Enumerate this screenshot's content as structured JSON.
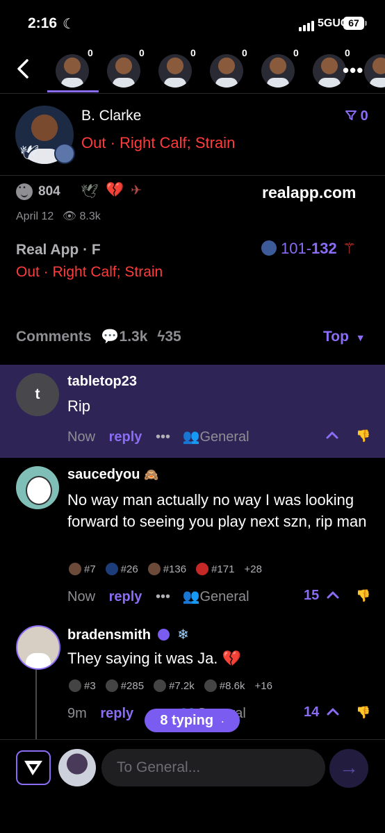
{
  "status_bar": {
    "time": "2:16",
    "network": "5GUC",
    "battery": "67"
  },
  "avatar_strip": {
    "counts": [
      "0",
      "0",
      "0",
      "0",
      "0",
      "0"
    ],
    "more": "•••"
  },
  "player": {
    "name": "B. Clarke",
    "status": "Out · Right Calf; Strain",
    "filter_count": "0"
  },
  "post": {
    "reaction_count": "804",
    "site": "realapp.com",
    "date": "April 12",
    "views": "8.3k",
    "source": "Real App · F",
    "score_home": "101",
    "score_sep": "-",
    "score_away": "132",
    "status": "Out · Right Calf; Strain"
  },
  "comments_header": {
    "label": "Comments",
    "count": "1.3k",
    "bolts": "35",
    "sort": "Top"
  },
  "comments": [
    {
      "user": "tabletop23",
      "avatar_letter": "t",
      "text": "Rip",
      "time": "Now",
      "reply": "reply",
      "more": "•••",
      "channel": "General",
      "votes": ""
    },
    {
      "user": "saucedyou",
      "text": "No way man actually no way I was looking forward to seeing you play next szn, rip man",
      "time": "Now",
      "reply": "reply",
      "more": "•••",
      "channel": "General",
      "votes": "15",
      "badges": [
        "#7",
        "#26",
        "#136",
        "#171",
        "+28"
      ]
    },
    {
      "user": "bradensmith",
      "text": "They saying it was Ja. 💔",
      "time": "9m",
      "reply": "reply",
      "channel": "General",
      "votes": "14",
      "badges": [
        "#3",
        "#285",
        "#7.2k",
        "#8.6k",
        "+16"
      ]
    }
  ],
  "typing": "8 typing",
  "composer": {
    "placeholder": "To General..."
  },
  "colors": {
    "accent": "#8b6cf5",
    "status_red": "#ff3b3b",
    "highlight_bg": "#2e2456"
  }
}
